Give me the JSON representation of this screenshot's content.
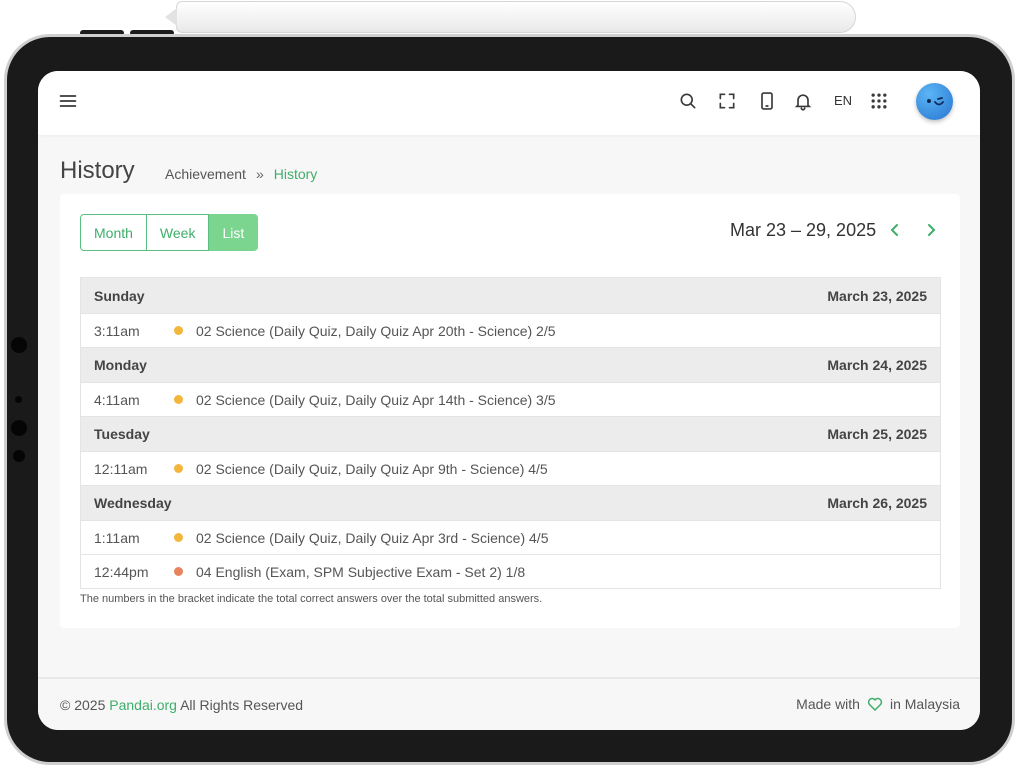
{
  "topbar": {
    "lang": "EN"
  },
  "page": {
    "title": "History",
    "breadcrumb": {
      "parent": "Achievement",
      "separator": "»",
      "current": "History"
    }
  },
  "calendar": {
    "views": [
      "Month",
      "Week",
      "List"
    ],
    "active_view": "List",
    "range": "Mar 23 – 29, 2025",
    "days": [
      {
        "day": "Sunday",
        "date": "March 23, 2025",
        "events": [
          {
            "time": "3:11am",
            "title": "02 Science (Daily Quiz, Daily Quiz Apr 20th - Science) 2/5",
            "color": "#f3b63c"
          }
        ]
      },
      {
        "day": "Monday",
        "date": "March 24, 2025",
        "events": [
          {
            "time": "4:11am",
            "title": "02 Science (Daily Quiz, Daily Quiz Apr 14th - Science) 3/5",
            "color": "#f3b63c"
          }
        ]
      },
      {
        "day": "Tuesday",
        "date": "March 25, 2025",
        "events": [
          {
            "time": "12:11am",
            "title": "02 Science (Daily Quiz, Daily Quiz Apr 9th - Science) 4/5",
            "color": "#f3b63c"
          }
        ]
      },
      {
        "day": "Wednesday",
        "date": "March 26, 2025",
        "events": [
          {
            "time": "1:11am",
            "title": "02 Science (Daily Quiz, Daily Quiz Apr 3rd - Science) 4/5",
            "color": "#f3b63c"
          },
          {
            "time": "12:44pm",
            "title": "04 English (Exam, SPM Subjective Exam - Set 2) 1/8",
            "color": "#e8845c"
          }
        ]
      }
    ],
    "footnote": "The numbers in the bracket indicate the total correct answers over the total submitted answers."
  },
  "footer": {
    "copyright_prefix": "© 2025 ",
    "brand": "Pandai.org",
    "copyright_suffix": " All Rights Reserved",
    "made_with": "Made with",
    "in_country": "in Malaysia"
  },
  "colors": {
    "accent": "#3fae6a",
    "active_view": "#7bd58f"
  }
}
